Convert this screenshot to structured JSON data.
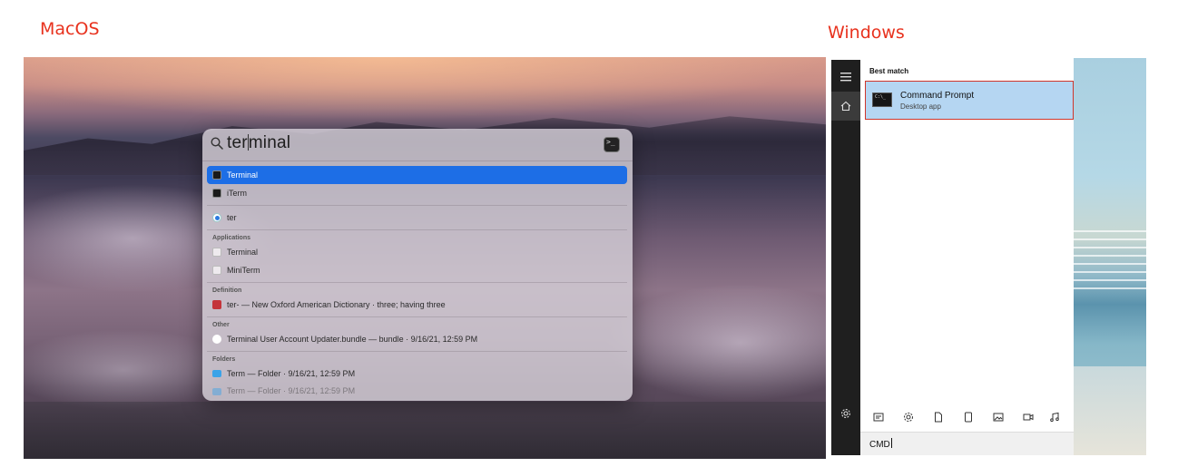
{
  "labels": {
    "mac": "MacOS",
    "windows": "Windows"
  },
  "spotlight": {
    "query_pre": "ter",
    "query_post": "minal",
    "top_hits": [
      {
        "label": "Terminal",
        "icon": "terminal-icon",
        "selected": true
      },
      {
        "label": "iTerm",
        "icon": "iterm-icon",
        "selected": false
      }
    ],
    "suggestion": {
      "label": "ter",
      "icon": "safari-icon"
    },
    "applications": {
      "header": "Applications",
      "items": [
        "Terminal",
        "MiniTerm"
      ]
    },
    "definition": {
      "header": "Definition",
      "text": "ter- — New Oxford American Dictionary · three; having three"
    },
    "other": {
      "header": "Other",
      "text": "Terminal User Account Updater.bundle — bundle · 9/16/21, 12:59 PM"
    },
    "folders": {
      "header": "Folders",
      "items": [
        "Term — Folder · 9/16/21, 12:59 PM",
        "Term — Folder · 9/16/21, 12:59 PM"
      ]
    }
  },
  "windows": {
    "best_match_label": "Best match",
    "result": {
      "title": "Command Prompt",
      "subtitle": "Desktop app"
    },
    "search_value": "CMD",
    "filter_icons": [
      "documents-icon",
      "settings-icon",
      "file-icon",
      "device-icon",
      "photos-icon",
      "video-icon",
      "music-icon"
    ]
  },
  "colors": {
    "label_red": "#e8321e",
    "mac_selection": "#1d6ee6",
    "win_highlight": "#b5d6f2",
    "win_border": "#d0362b"
  }
}
